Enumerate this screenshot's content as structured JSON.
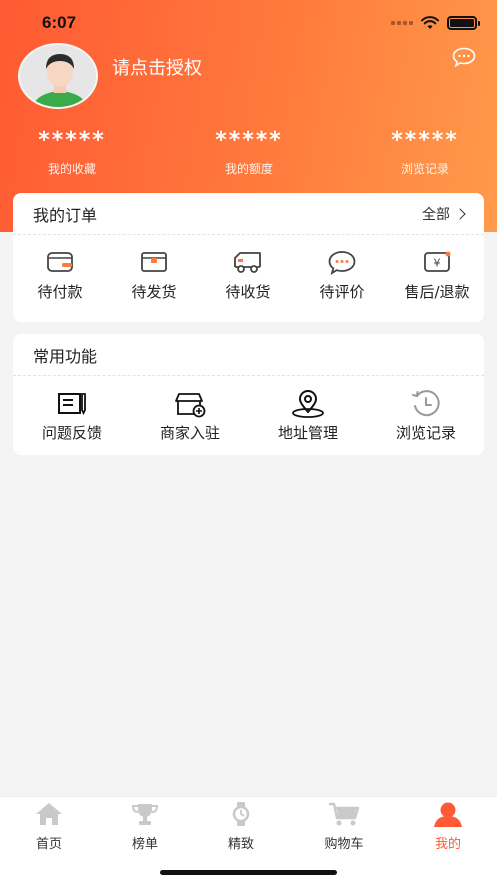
{
  "status": {
    "time": "6:07"
  },
  "profile": {
    "login_prompt": "请点击授权"
  },
  "stats": [
    {
      "value": "*****",
      "label": "我的收藏"
    },
    {
      "value": "*****",
      "label": "我的额度"
    },
    {
      "value": "*****",
      "label": "浏览记录"
    }
  ],
  "orders": {
    "title": "我的订单",
    "all_label": "全部",
    "items": [
      {
        "label": "待付款",
        "icon": "wallet-icon"
      },
      {
        "label": "待发货",
        "icon": "package-icon"
      },
      {
        "label": "待收货",
        "icon": "truck-icon"
      },
      {
        "label": "待评价",
        "icon": "comment-icon"
      },
      {
        "label": "售后/退款",
        "icon": "refund-icon"
      }
    ]
  },
  "functions": {
    "title": "常用功能",
    "items": [
      {
        "label": "问题反馈",
        "icon": "feedback-icon"
      },
      {
        "label": "商家入驻",
        "icon": "store-icon"
      },
      {
        "label": "地址管理",
        "icon": "location-icon"
      },
      {
        "label": "浏览记录",
        "icon": "history-icon"
      }
    ]
  },
  "tabbar": {
    "items": [
      {
        "label": "首页",
        "icon": "home-icon"
      },
      {
        "label": "榜单",
        "icon": "trophy-icon"
      },
      {
        "label": "精致",
        "icon": "watch-icon"
      },
      {
        "label": "购物车",
        "icon": "cart-icon"
      },
      {
        "label": "我的",
        "icon": "profile-icon"
      }
    ],
    "active_color": "#ff5a33"
  },
  "colors": {
    "accent": "#ff5a33",
    "accent_end": "#ff9a4a"
  }
}
